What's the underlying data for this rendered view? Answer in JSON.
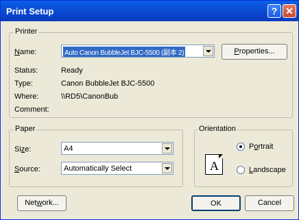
{
  "window": {
    "title": "Print Setup",
    "help_glyph": "?",
    "close_glyph": "✕"
  },
  "printer": {
    "group_label": "Printer",
    "name_label": "Name:",
    "name_value": "Auto Canon BubbleJet BJC-5500 (副本 2)",
    "properties_label": "Properties...",
    "status_label": "Status:",
    "status_value": "Ready",
    "type_label": "Type:",
    "type_value": "Canon BubbleJet BJC-5500",
    "where_label": "Where:",
    "where_value": "\\\\RD5\\CanonBub",
    "comment_label": "Comment:"
  },
  "paper": {
    "group_label": "Paper",
    "size_label": "Size:",
    "size_value": "A4",
    "source_label": "Source:",
    "source_value": "Automatically Select"
  },
  "orientation": {
    "group_label": "Orientation",
    "preview_letter": "A",
    "portrait_label": "Portrait",
    "landscape_label": "Landscape",
    "selected": "portrait"
  },
  "buttons": {
    "network": "Network...",
    "ok": "OK",
    "cancel": "Cancel"
  }
}
